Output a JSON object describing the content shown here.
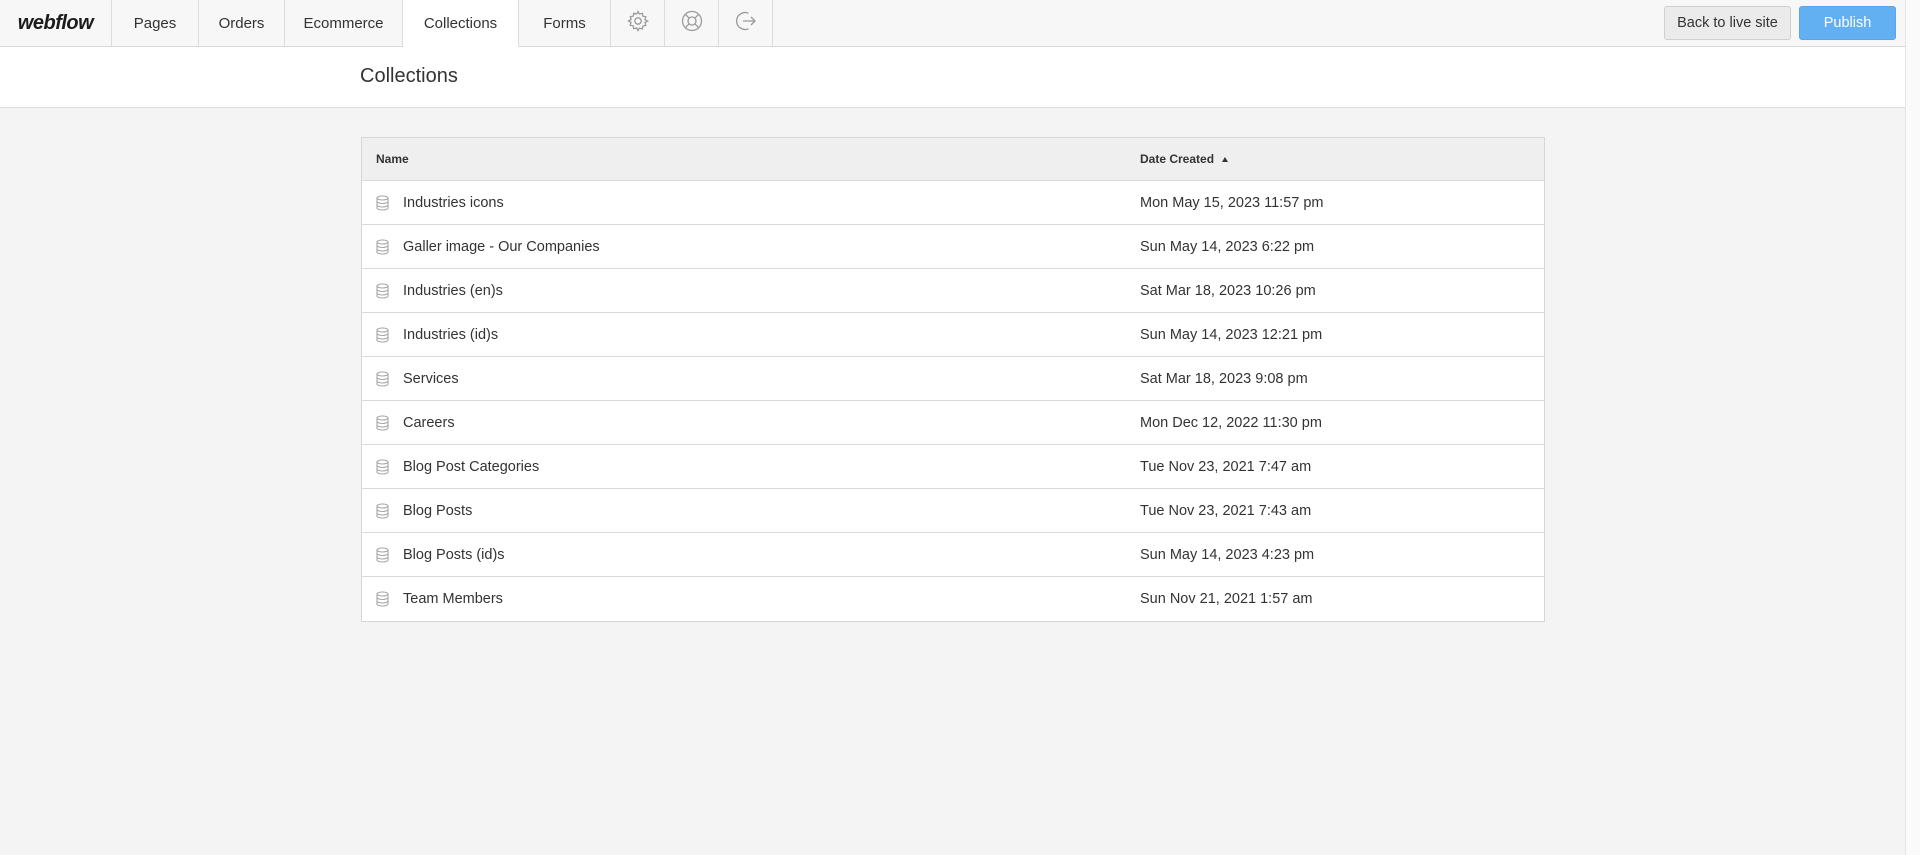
{
  "app": {
    "logo": "webflow"
  },
  "nav": {
    "tabs": [
      {
        "label": "Pages"
      },
      {
        "label": "Orders"
      },
      {
        "label": "Ecommerce"
      },
      {
        "label": "Collections",
        "active": true
      },
      {
        "label": "Forms"
      }
    ],
    "icons": [
      "gear-icon",
      "help-lifebuoy-icon",
      "logout-icon"
    ]
  },
  "actions": {
    "back_label": "Back to live site",
    "publish_label": "Publish"
  },
  "page": {
    "title": "Collections"
  },
  "table": {
    "columns": {
      "name": "Name",
      "date": "Date Created"
    },
    "sort": {
      "column": "date",
      "direction": "ascending"
    },
    "rows": [
      {
        "name": "Industries icons",
        "date": "Mon May 15, 2023 11:57 pm"
      },
      {
        "name": "Galler image - Our Companies",
        "date": "Sun May 14, 2023 6:22 pm"
      },
      {
        "name": "Industries (en)s",
        "date": "Sat Mar 18, 2023 10:26 pm"
      },
      {
        "name": "Industries (id)s",
        "date": "Sun May 14, 2023 12:21 pm"
      },
      {
        "name": "Services",
        "date": "Sat Mar 18, 2023 9:08 pm"
      },
      {
        "name": "Careers",
        "date": "Mon Dec 12, 2022 11:30 pm"
      },
      {
        "name": "Blog Post Categories",
        "date": "Tue Nov 23, 2021 7:47 am"
      },
      {
        "name": "Blog Posts",
        "date": "Tue Nov 23, 2021 7:43 am"
      },
      {
        "name": "Blog Posts (id)s",
        "date": "Sun May 14, 2023 4:23 pm"
      },
      {
        "name": "Team Members",
        "date": "Sun Nov 21, 2021 1:57 am"
      }
    ]
  },
  "colors": {
    "publish": "#62b0f2",
    "background": "#f4f4f4",
    "header_bg": "#efefef"
  }
}
